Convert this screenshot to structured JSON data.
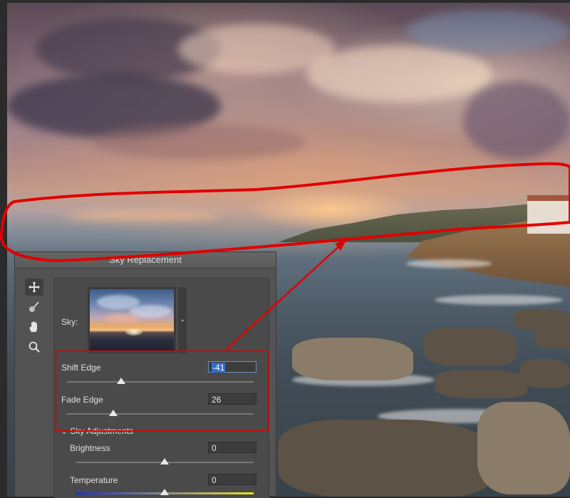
{
  "dialog": {
    "title": "Sky Replacement",
    "tools": [
      {
        "name": "move-tool",
        "icon": "move-icon",
        "active": true
      },
      {
        "name": "sky-brush-tool",
        "icon": "brush-icon",
        "active": false
      },
      {
        "name": "hand-tool",
        "icon": "hand-icon",
        "active": false
      },
      {
        "name": "zoom-tool",
        "icon": "zoom-icon",
        "active": false
      }
    ],
    "sky_label": "Sky:",
    "shift_edge": {
      "label": "Shift Edge",
      "value": "-41",
      "slider_value": -41
    },
    "fade_edge": {
      "label": "Fade Edge",
      "value": "26",
      "slider_value": 26
    },
    "sky_adjustments": {
      "label": "Sky Adjustments",
      "brightness": {
        "label": "Brightness",
        "value": "0"
      },
      "temperature": {
        "label": "Temperature",
        "value": "0"
      }
    }
  },
  "colors": {
    "annotation": "#e00000",
    "selection": "#2f6dd0",
    "dialog_bg": "#535353",
    "panel_bg": "#4a4a4a"
  }
}
